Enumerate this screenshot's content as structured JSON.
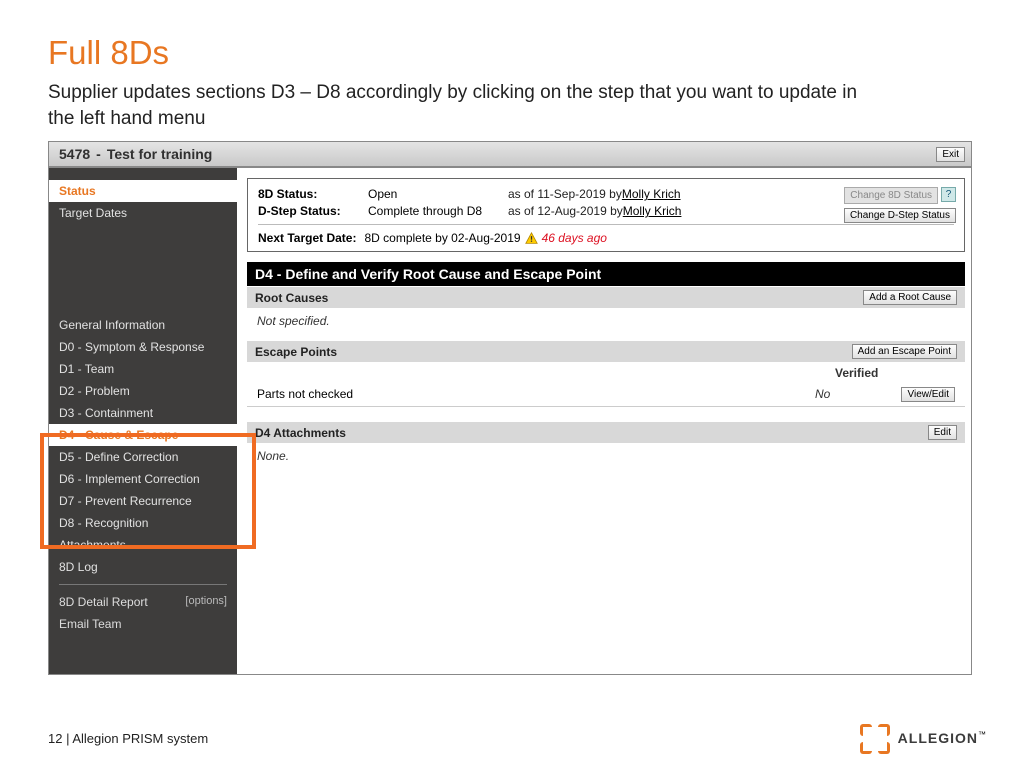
{
  "slide": {
    "title": "Full 8Ds",
    "subtitle": "Supplier updates sections D3 – D8 accordingly by clicking on the step that you want to update in the left hand menu"
  },
  "app": {
    "id": "5478",
    "dash": "-",
    "name": "Test for training",
    "exit": "Exit"
  },
  "sidebar": {
    "status_tab": "Status",
    "target_dates": "Target Dates",
    "items": [
      "General Information",
      "D0 - Symptom & Response",
      "D1 - Team",
      "D2 - Problem",
      "D3 - Containment",
      "D4 - Cause & Escape",
      "D5 - Define Correction",
      "D6 - Implement Correction",
      "D7 - Prevent Recurrence",
      "D8 - Recognition"
    ],
    "attachments": "Attachments",
    "log": "8D Log",
    "report": "8D Detail Report",
    "options": "[options]",
    "email": "Email Team"
  },
  "status": {
    "l1": "8D Status:",
    "v1": "Open",
    "asof1": "as of 11-Sep-2019 by ",
    "who1": "Molly Krich",
    "l2": "D-Step Status:",
    "v2": "Complete through D8",
    "asof2": "as of 12-Aug-2019 by ",
    "who2": "Molly Krich",
    "next_label": "Next Target Date:",
    "next_val": "8D complete by 02-Aug-2019",
    "ago": "46 days ago",
    "change_8d": "Change 8D Status",
    "help": "?",
    "change_dstep": "Change D-Step Status"
  },
  "d4": {
    "header": "D4 - Define and Verify Root Cause and Escape Point",
    "root_causes": "Root Causes",
    "add_root": "Add a Root Cause",
    "not_specified": "Not specified.",
    "escape_points": "Escape Points",
    "add_escape": "Add an Escape Point",
    "verified_col": "Verified",
    "ep1_name": "Parts not checked",
    "ep1_verified": "No",
    "view_edit": "View/Edit",
    "attachments": "D4 Attachments",
    "edit": "Edit",
    "none": "None."
  },
  "footer": {
    "text": "12 | Allegion PRISM system"
  },
  "logo": {
    "text": "ALLEGION",
    "tm": "™"
  }
}
